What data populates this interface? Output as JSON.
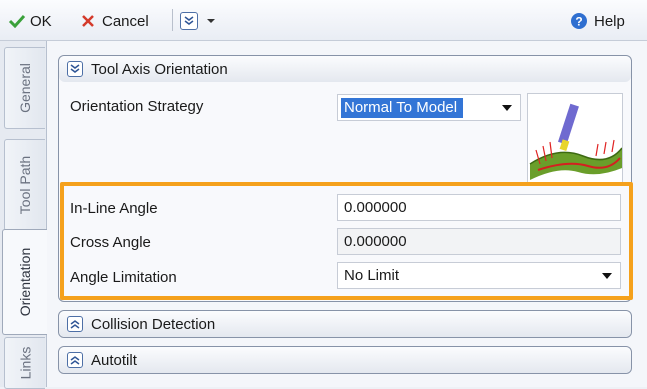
{
  "toolbar": {
    "ok_label": "OK",
    "cancel_label": "Cancel",
    "help_label": "Help"
  },
  "side_tabs": [
    "General",
    "Tool Path",
    "Orientation",
    "Links"
  ],
  "active_tab": "Orientation",
  "tool_axis": {
    "title": "Tool Axis Orientation",
    "strategy_label": "Orientation Strategy",
    "strategy_value": "Normal To Model",
    "inline_angle_label": "In-Line Angle",
    "inline_angle_value": "0.000000",
    "cross_angle_label": "Cross Angle",
    "cross_angle_value": "0.000000",
    "angle_limitation_label": "Angle Limitation",
    "angle_limitation_value": "No Limit"
  },
  "collision": {
    "title": "Collision Detection"
  },
  "autotilt": {
    "title": "Autotilt"
  },
  "colors": {
    "highlight": "#f5a11c",
    "selection": "#3375d6"
  }
}
